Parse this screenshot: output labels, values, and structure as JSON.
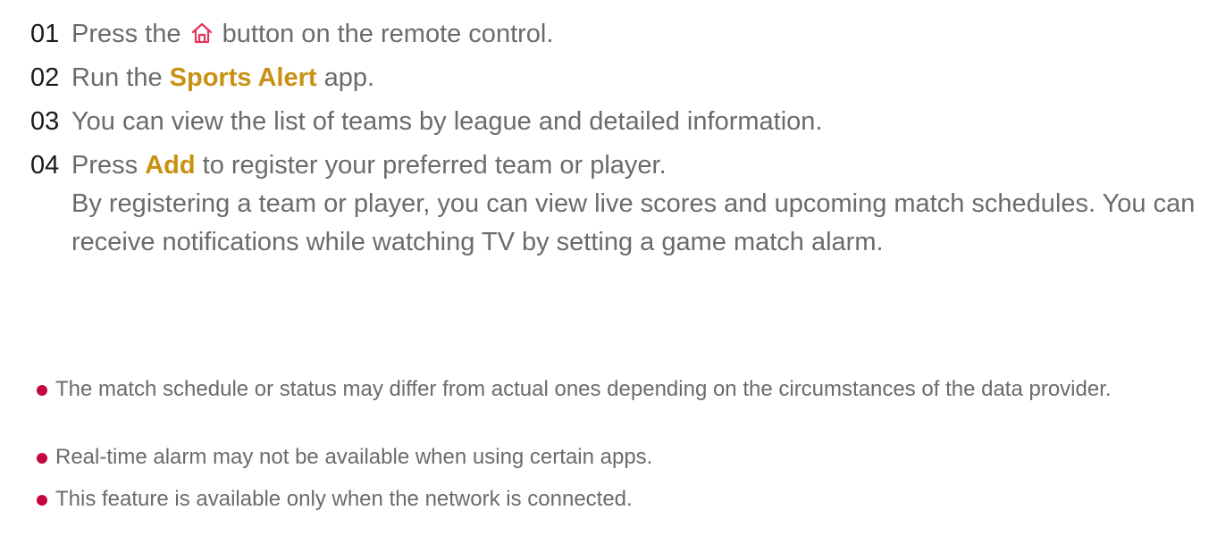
{
  "steps": [
    {
      "number": "01",
      "before_icon": "Press the",
      "icon": "home-icon",
      "after_icon": "button on the remote control."
    },
    {
      "number": "02",
      "before": "Run the",
      "emphasis": "Sports Alert",
      "after": "app."
    },
    {
      "number": "03",
      "text": "You can view the list of teams by league and detailed information."
    },
    {
      "number": "04",
      "before": "Press",
      "emphasis": "Add",
      "after": "to register your preferred team or player.",
      "detail": "By registering a team or player, you can view live scores and upcoming match schedules. You can receive notifications while watching TV by setting a game match alarm."
    }
  ],
  "notes": [
    "The match schedule or status may differ from actual ones depending on the circumstances of the data provider.",
    "Real-time alarm may not be available when using certain apps.",
    "This feature is available only when the network is connected."
  ],
  "colors": {
    "emphasis": "#c99113",
    "bullet": "#c3063f",
    "icon": "#e0375a",
    "body_text": "#6b6b6b",
    "step_number": "#1a1a1a"
  }
}
